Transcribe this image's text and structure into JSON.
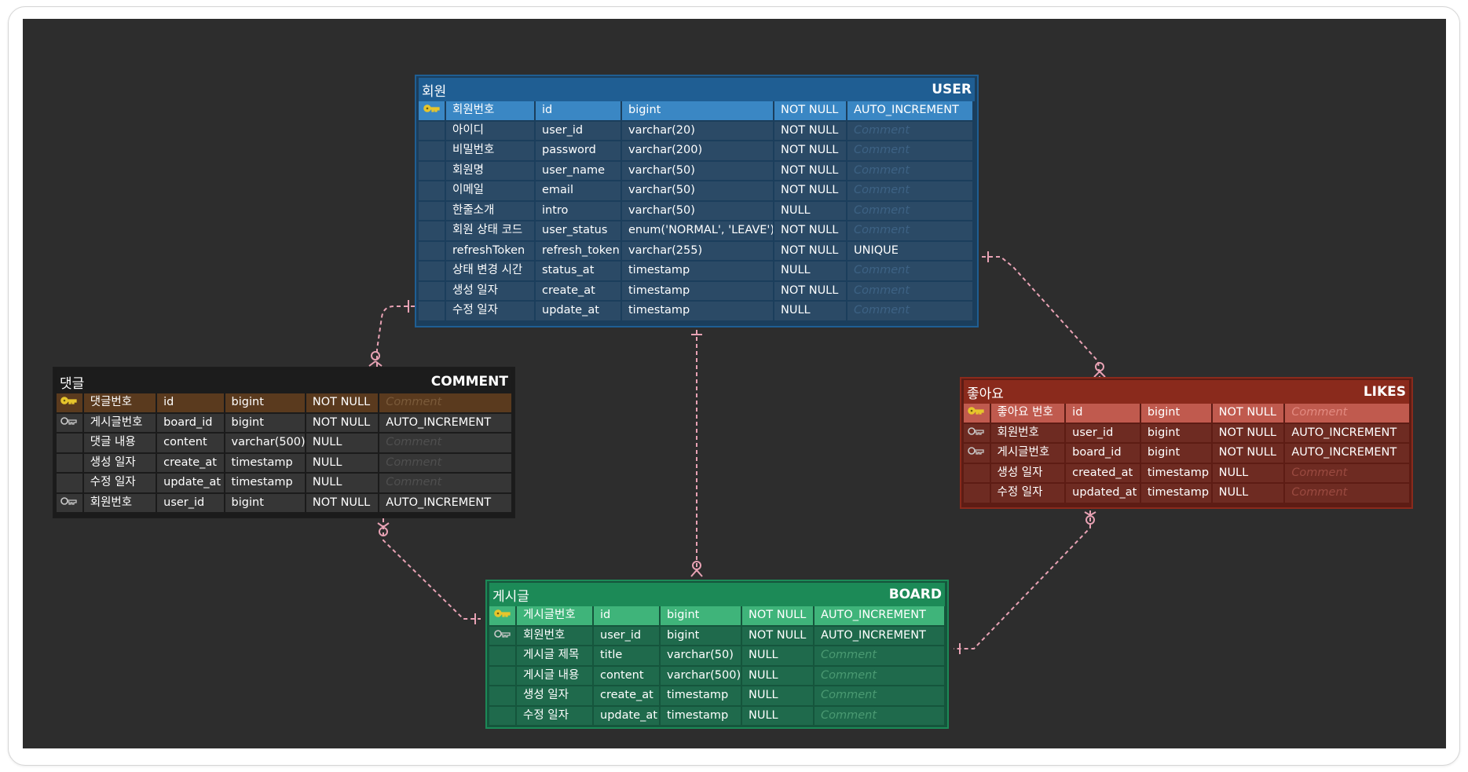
{
  "tables": {
    "user": {
      "logical": "회원",
      "physical": "USER",
      "rows": [
        {
          "key": "pk",
          "logical": "회원번호",
          "physical": "id",
          "type": "bigint",
          "nullable": "NOT NULL",
          "extra": "AUTO_INCREMENT"
        },
        {
          "key": "",
          "logical": "아이디",
          "physical": "user_id",
          "type": "varchar(20)",
          "nullable": "NOT NULL",
          "extra": "Comment"
        },
        {
          "key": "",
          "logical": "비밀번호",
          "physical": "password",
          "type": "varchar(200)",
          "nullable": "NOT NULL",
          "extra": "Comment"
        },
        {
          "key": "",
          "logical": "회원명",
          "physical": "user_name",
          "type": "varchar(50)",
          "nullable": "NOT NULL",
          "extra": "Comment"
        },
        {
          "key": "",
          "logical": "이메일",
          "physical": "email",
          "type": "varchar(50)",
          "nullable": "NOT NULL",
          "extra": "Comment"
        },
        {
          "key": "",
          "logical": "한줄소개",
          "physical": "intro",
          "type": "varchar(50)",
          "nullable": "NULL",
          "extra": "Comment"
        },
        {
          "key": "",
          "logical": "회원 상태 코드",
          "physical": "user_status",
          "type": "enum('NORMAL', 'LEAVE')",
          "nullable": "NOT NULL",
          "extra": "Comment"
        },
        {
          "key": "",
          "logical": "refreshToken",
          "physical": "refresh_token",
          "type": "varchar(255)",
          "nullable": "NOT NULL",
          "extra": "UNIQUE"
        },
        {
          "key": "",
          "logical": "상태 변경 시간",
          "physical": "status_at",
          "type": "timestamp",
          "nullable": "NULL",
          "extra": "Comment"
        },
        {
          "key": "",
          "logical": "생성 일자",
          "physical": "create_at",
          "type": "timestamp",
          "nullable": "NOT NULL",
          "extra": "Comment"
        },
        {
          "key": "",
          "logical": "수정 일자",
          "physical": "update_at",
          "type": "timestamp",
          "nullable": "NULL",
          "extra": "Comment"
        }
      ]
    },
    "comment": {
      "logical": "댓글",
      "physical": "COMMENT",
      "rows": [
        {
          "key": "pk",
          "logical": "댓글번호",
          "physical": "id",
          "type": "bigint",
          "nullable": "NOT NULL",
          "extra": "Comment"
        },
        {
          "key": "fk",
          "logical": "게시글번호",
          "physical": "board_id",
          "type": "bigint",
          "nullable": "NOT NULL",
          "extra": "AUTO_INCREMENT"
        },
        {
          "key": "",
          "logical": "댓글 내용",
          "physical": "content",
          "type": "varchar(500)",
          "nullable": "NULL",
          "extra": "Comment"
        },
        {
          "key": "",
          "logical": "생성 일자",
          "physical": "create_at",
          "type": "timestamp",
          "nullable": "NULL",
          "extra": "Comment"
        },
        {
          "key": "",
          "logical": "수정 일자",
          "physical": "update_at",
          "type": "timestamp",
          "nullable": "NULL",
          "extra": "Comment"
        },
        {
          "key": "fk",
          "logical": "회원번호",
          "physical": "user_id",
          "type": "bigint",
          "nullable": "NOT NULL",
          "extra": "AUTO_INCREMENT"
        }
      ]
    },
    "likes": {
      "logical": "좋아요",
      "physical": "LIKES",
      "rows": [
        {
          "key": "pk",
          "logical": "좋아요 번호",
          "physical": "id",
          "type": "bigint",
          "nullable": "NOT NULL",
          "extra": "Comment"
        },
        {
          "key": "fk",
          "logical": "회원번호",
          "physical": "user_id",
          "type": "bigint",
          "nullable": "NOT NULL",
          "extra": "AUTO_INCREMENT"
        },
        {
          "key": "fk",
          "logical": "게시글번호",
          "physical": "board_id",
          "type": "bigint",
          "nullable": "NOT NULL",
          "extra": "AUTO_INCREMENT"
        },
        {
          "key": "",
          "logical": "생성 일자",
          "physical": "created_at",
          "type": "timestamp",
          "nullable": "NULL",
          "extra": "Comment"
        },
        {
          "key": "",
          "logical": "수정 일자",
          "physical": "updated_at",
          "type": "timestamp",
          "nullable": "NULL",
          "extra": "Comment"
        }
      ]
    },
    "board": {
      "logical": "게시글",
      "physical": "BOARD",
      "rows": [
        {
          "key": "pk",
          "logical": "게시글번호",
          "physical": "id",
          "type": "bigint",
          "nullable": "NOT NULL",
          "extra": "AUTO_INCREMENT"
        },
        {
          "key": "fk",
          "logical": "회원번호",
          "physical": "user_id",
          "type": "bigint",
          "nullable": "NOT NULL",
          "extra": "AUTO_INCREMENT"
        },
        {
          "key": "",
          "logical": "게시글 제목",
          "physical": "title",
          "type": "varchar(50)",
          "nullable": "NULL",
          "extra": "Comment"
        },
        {
          "key": "",
          "logical": "게시글 내용",
          "physical": "content",
          "type": "varchar(500)",
          "nullable": "NULL",
          "extra": "Comment"
        },
        {
          "key": "",
          "logical": "생성 일자",
          "physical": "create_at",
          "type": "timestamp",
          "nullable": "NULL",
          "extra": "Comment"
        },
        {
          "key": "",
          "logical": "수정 일자",
          "physical": "update_at",
          "type": "timestamp",
          "nullable": "NULL",
          "extra": "Comment"
        }
      ]
    }
  },
  "icons": {
    "primary_key": "key-icon-gold",
    "foreign_key": "key-icon-outline"
  },
  "colors": {
    "canvas": "#2d2d2d",
    "relation_line": "#e8a2b4",
    "primary_key_icon": "#e6c52c",
    "foreign_key_icon": "#c9c9c9"
  }
}
